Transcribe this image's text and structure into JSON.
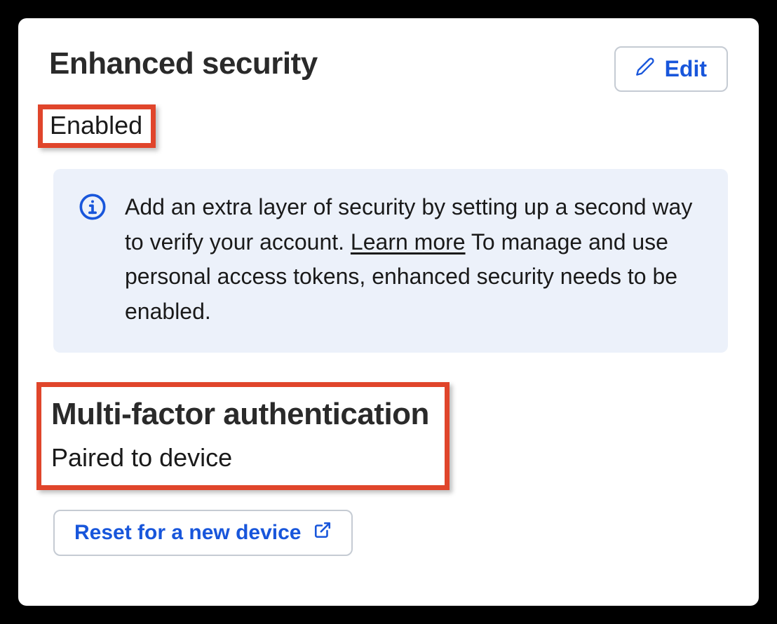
{
  "header": {
    "title": "Enhanced security",
    "edit_label": "Edit"
  },
  "status": {
    "value": "Enabled"
  },
  "info": {
    "text_part1": "Add an extra layer of security by setting up a second way to verify your account. ",
    "learn_more": "Learn more",
    "text_part2": " To manage and use personal access tokens, enhanced security needs to be enabled."
  },
  "mfa": {
    "title": "Multi-factor authentication",
    "status": "Paired to device",
    "reset_label": "Reset for a new device"
  }
}
